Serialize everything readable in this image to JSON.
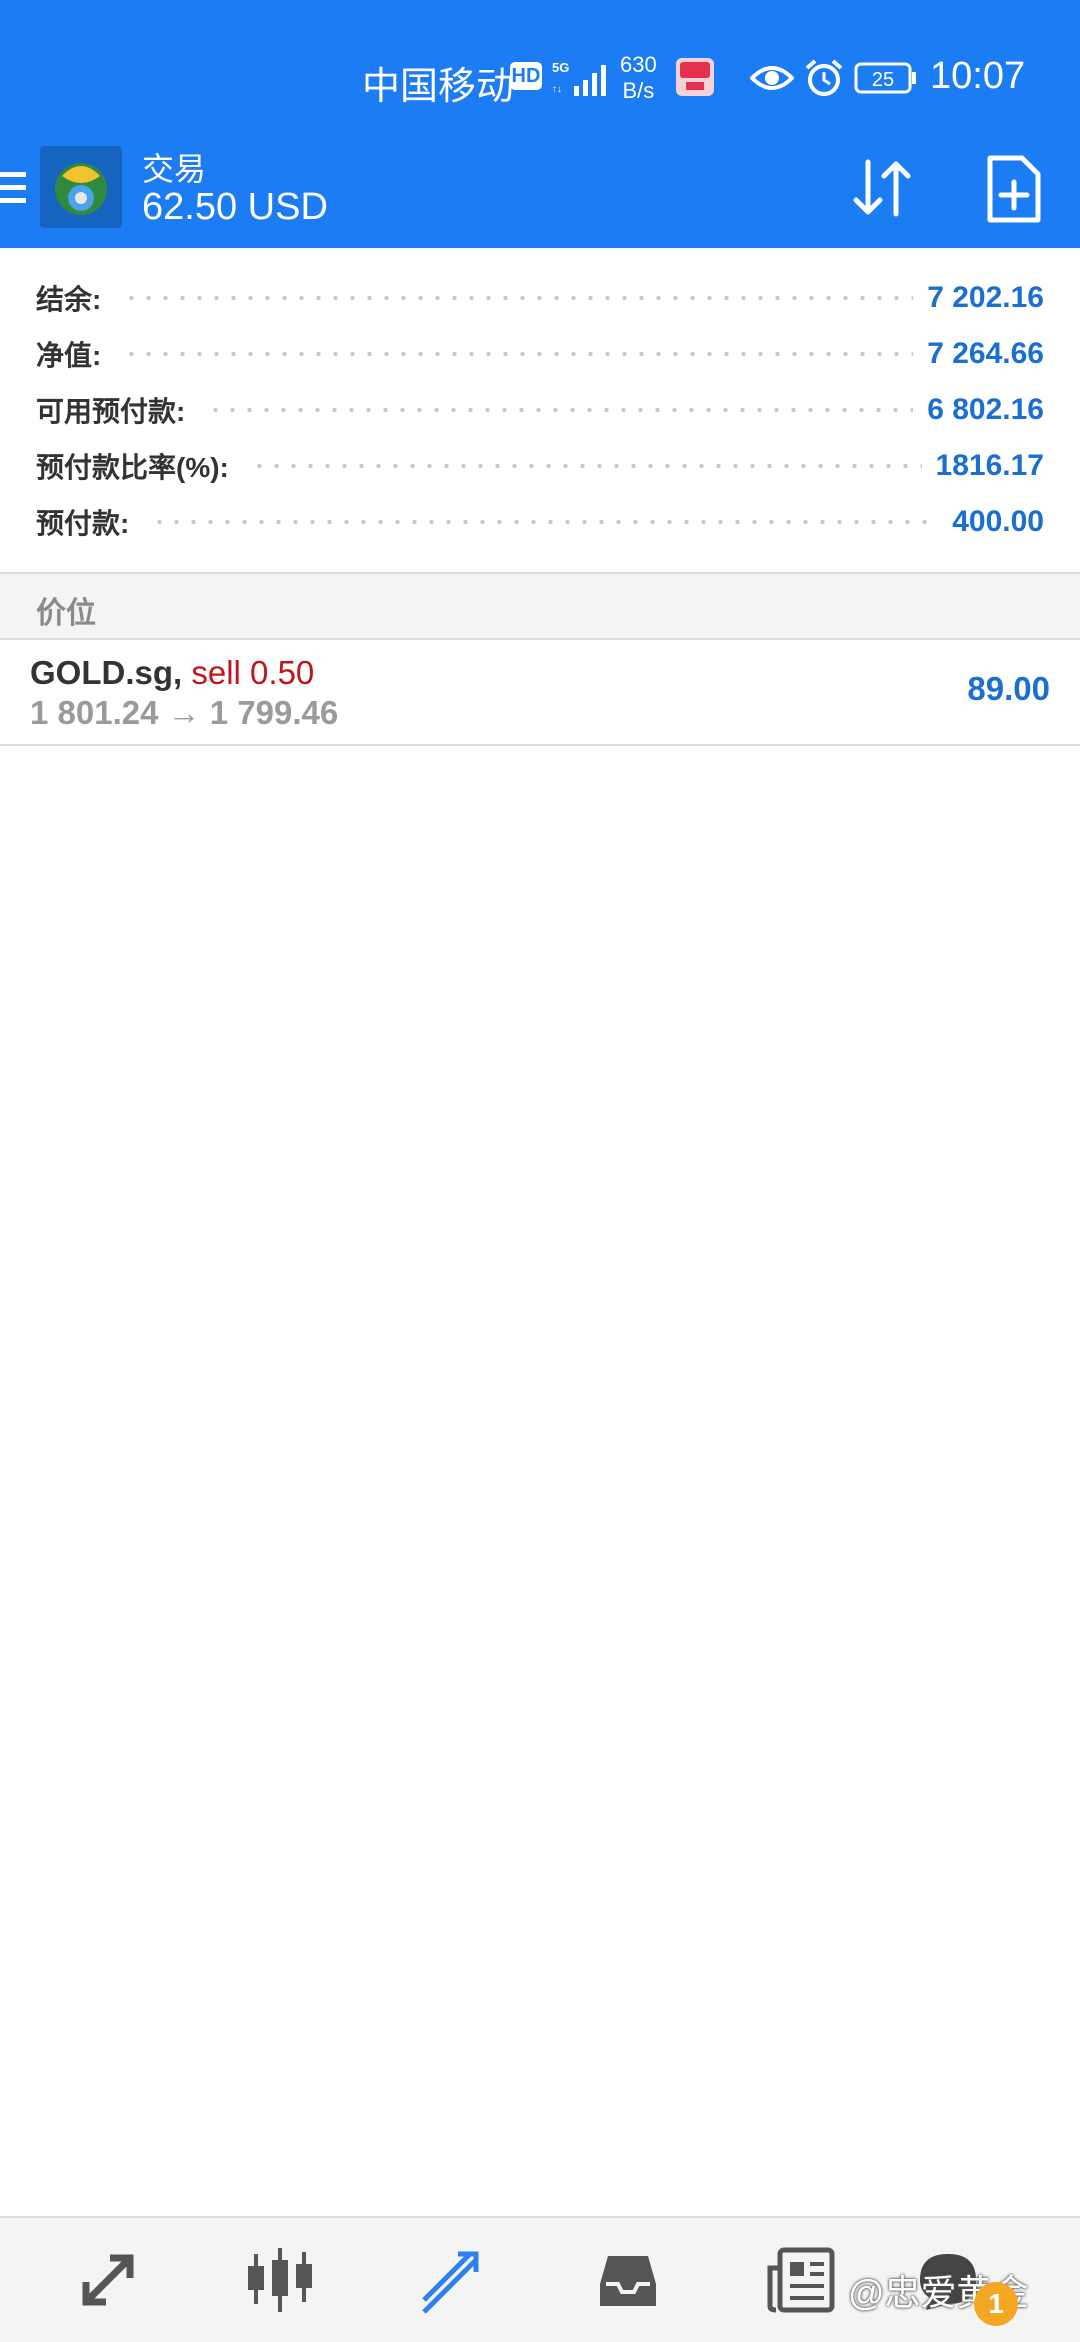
{
  "status_bar": {
    "carrier": "中国移动",
    "hd": "HD",
    "network": "5G",
    "speed_value": "630",
    "speed_unit": "B/s",
    "battery": "25",
    "time": "10:07"
  },
  "app_bar": {
    "title": "交易",
    "subtitle": "62.50 USD"
  },
  "summary": [
    {
      "label": "结余:",
      "value": "7 202.16"
    },
    {
      "label": "净值:",
      "value": "7 264.66"
    },
    {
      "label": "可用预付款:",
      "value": "6 802.16"
    },
    {
      "label": "预付款比率(%):",
      "value": "1816.17"
    },
    {
      "label": "预付款:",
      "value": "400.00"
    }
  ],
  "section_header": "价位",
  "position": {
    "symbol": "GOLD.sg,",
    "action": "sell 0.50",
    "prices": "1 801.24 → 1 799.46",
    "profit": "89.00"
  },
  "bottom_nav": {
    "items": [
      "quotes",
      "chart",
      "trade",
      "history",
      "news",
      "chat"
    ],
    "active": "trade",
    "badge": "1"
  },
  "watermark": "@忠爱黄金",
  "colors": {
    "primary": "#1c7cf4",
    "value_blue": "#1a6fd1",
    "sell_red": "#c0161b",
    "nav_active": "#2f80ed",
    "nav_inactive": "#555555",
    "badge": "#f5a623"
  }
}
